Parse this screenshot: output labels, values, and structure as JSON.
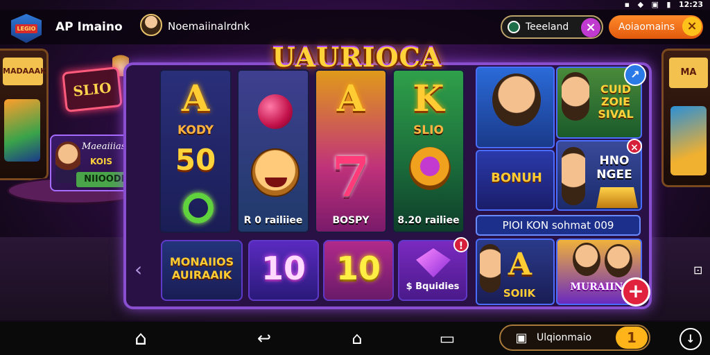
{
  "status": {
    "time": "12:23"
  },
  "header": {
    "logo_text": "LEGIO",
    "title": "AP  Imaino",
    "user_name": "Noemaiinalrdnk",
    "pill_dark_label": "Teeeland",
    "pill_orange_label": "Aoiaomains",
    "close_glyph": "×"
  },
  "left_scene": {
    "sign_text": "SLIO",
    "machine_left_marquee": "MADAAAK",
    "machine_right_marquee": "MA",
    "promo_line1": "Maeaiiiaso",
    "promo_line2": "KOIS",
    "promo_line3": "NIIOODIS"
  },
  "game": {
    "title": "UAURIOCA",
    "reels": [
      {
        "big": "A",
        "sub": "KODY",
        "mid": "50",
        "foot": ""
      },
      {
        "big": "",
        "sub": "",
        "mid": "",
        "foot": "R 0 railiiee"
      },
      {
        "big": "A",
        "sub": "",
        "mid": "",
        "foot": "BOSPY"
      },
      {
        "big": "K",
        "sub": "SLIO",
        "mid": "",
        "foot": "8.20 railiee"
      }
    ],
    "bottom_tiles": [
      {
        "label": "MONAIIOS AUIRAAIK"
      },
      {
        "label": "10"
      },
      {
        "label": "10"
      },
      {
        "label": "$ Bquidies"
      }
    ]
  },
  "side": {
    "card_club": "CUID ZOIE SIVAL",
    "card_bonus": "BONUH",
    "card_house": "HNO NGEE",
    "promo_bar": "PIOI KON sohmat 009",
    "card_soon_big": "A",
    "card_soon_text": "SOIIK",
    "card_bottom_right": "MURAIINC"
  },
  "navbar": {
    "pill_label": "Ulqionmaio",
    "pill_button": "1"
  },
  "colors": {
    "accent": "#8a4fd0",
    "gold": "#ffd23a",
    "orange": "#ff8a2a",
    "danger": "#e0223e"
  }
}
